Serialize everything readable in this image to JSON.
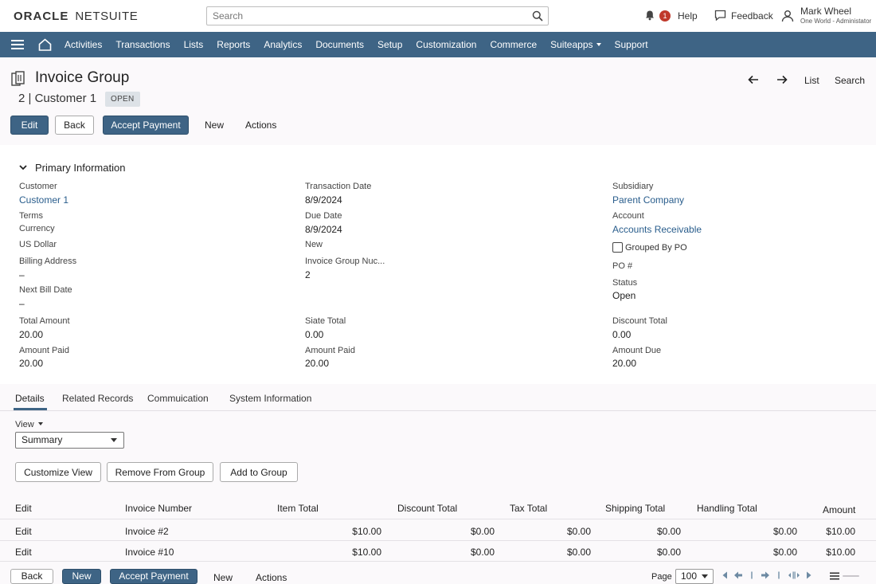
{
  "header": {
    "logo_oracle": "ORACLE",
    "logo_netsuite": "NETSUITE",
    "search_placeholder": "Search",
    "notification_count": "1",
    "help": "Help",
    "feedback": "Feedback",
    "user_name": "Mark Wheel",
    "user_role": "One World - Administator"
  },
  "nav": {
    "items": [
      "Activities",
      "Transactions",
      "Lists",
      "Reports",
      "Analytics",
      "Documents",
      "Setup",
      "Customization",
      "Commerce",
      "Suiteapps",
      "Support"
    ]
  },
  "record": {
    "title": "Invoice Group",
    "subtitle": "2 | Customer 1",
    "status": "OPEN",
    "nav_list": "List",
    "nav_search": "Search"
  },
  "actions": {
    "edit": "Edit",
    "back": "Back",
    "accept_payment": "Accept Payment",
    "new": "New",
    "actions": "Actions"
  },
  "primary": {
    "heading": "Primary Information",
    "customer_label": "Customer",
    "customer_value": "Customer 1",
    "terms_label": "Terms",
    "currency_label": "Currency",
    "currency_value": "US Dollar",
    "billing_label": "Billing Address",
    "billing_value": "–",
    "next_bill_label": "Next Bill Date",
    "next_bill_value": "–",
    "trans_date_label": "Transaction Date",
    "trans_date_value": "8/9/2024",
    "due_date_label": "Due Date",
    "due_date_value": "8/9/2024",
    "new_value": "New",
    "group_num_label": "Invoice Group Nuc...",
    "group_num_value": "2",
    "subsidiary_label": "Subsidiary",
    "subsidiary_value": "Parent Company",
    "account_label": "Account",
    "account_value": "Accounts Receivable",
    "grouped_by_po": "Grouped By PO",
    "po_label": "PO #",
    "status_label": "Status",
    "status_value": "Open",
    "total_amount_label": "Total Amount",
    "total_amount_value": "20.00",
    "siate_total_label": "Siate Total",
    "siate_total_value": "0.00",
    "discount_total_label": "Discount Total",
    "discount_total_value": "0.00",
    "amount_paid_label": "Amount Paid",
    "amount_paid_value": "20.00",
    "amount_paid2_label": "Amount Paid",
    "amount_paid2_value": "20.00",
    "amount_due_label": "Amount Due",
    "amount_due_value": "20.00"
  },
  "tabs": [
    "Details",
    "Related Records",
    "Commuication",
    "System Information"
  ],
  "view": {
    "label": "View",
    "selected": "Summary"
  },
  "buttons": {
    "customize_view": "Customize View",
    "remove_from_group": "Remove From Group",
    "add_to_group": "Add to Group"
  },
  "table": {
    "headers": [
      "Edit",
      "Invoice Number",
      "Item Total",
      "Discount Total",
      "Tax Total",
      "Shipping Total",
      "Handling Total",
      "Amount"
    ],
    "rows": [
      {
        "edit": "Edit",
        "invoice": "Invoice #2",
        "item_total": "$10.00",
        "discount_total": "$0.00",
        "tax_total": "$0.00",
        "shipping_total": "$0.00",
        "handling_total": "$0.00",
        "amount": "$10.00"
      },
      {
        "edit": "Edit",
        "invoice": "Invoice #10",
        "item_total": "$10.00",
        "discount_total": "$0.00",
        "tax_total": "$0.00",
        "shipping_total": "$0.00",
        "handling_total": "$0.00",
        "amount": "$10.00"
      }
    ]
  },
  "footer": {
    "back": "Back",
    "new_primary": "New",
    "accept_payment": "Accept Payment",
    "new": "New",
    "actions": "Actions",
    "page_label": "Page",
    "page_size": "100"
  }
}
